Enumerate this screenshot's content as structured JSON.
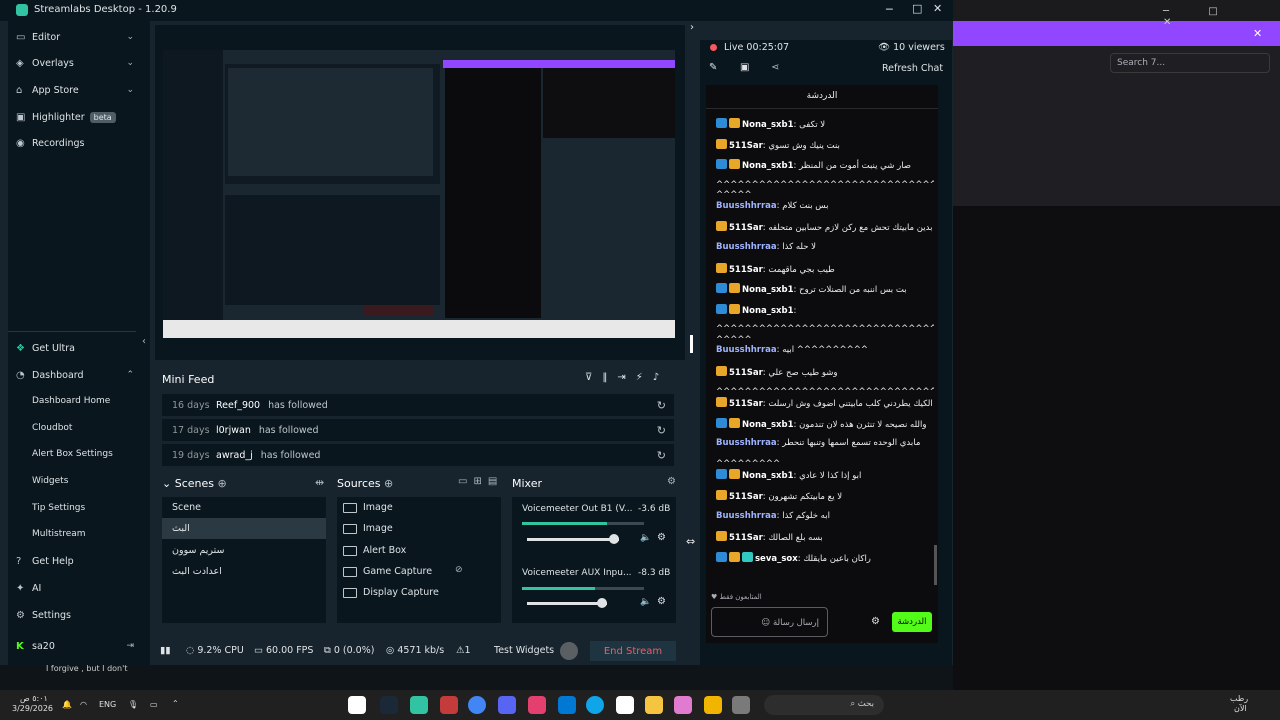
{
  "window": {
    "title": "Streamlabs Desktop - 1.20.9"
  },
  "sidebar": {
    "items": [
      {
        "label": "Editor"
      },
      {
        "label": "Overlays"
      },
      {
        "label": "App Store"
      },
      {
        "label": "Highlighter",
        "badge": "beta"
      },
      {
        "label": "Recordings"
      }
    ],
    "get_ultra": "Get Ultra",
    "dashboard": "Dashboard",
    "dashboard_items": [
      "Dashboard Home",
      "Cloudbot",
      "Alert Box Settings",
      "Widgets",
      "Tip Settings",
      "Multistream"
    ],
    "get_help": "Get Help",
    "ai": "AI",
    "settings": "Settings",
    "user": "sa20"
  },
  "mini_feed": {
    "title": "Mini Feed",
    "rows": [
      {
        "days": "16 days",
        "name": "Reef_900",
        "action": "has followed"
      },
      {
        "days": "17 days",
        "name": "l0rjwan",
        "action": "has followed"
      },
      {
        "days": "19 days",
        "name": "awrad_j",
        "action": "has followed"
      }
    ]
  },
  "scenes": {
    "title": "Scenes",
    "items": [
      "Scene",
      "البث",
      "ستريم سوون",
      "اعدادت البث"
    ]
  },
  "sources": {
    "title": "Sources",
    "items": [
      "Image",
      "Image",
      "Alert Box",
      "Game Capture",
      "Display Capture"
    ]
  },
  "mixer": {
    "title": "Mixer",
    "channels": [
      {
        "name": "Voicemeeter Out B1 (V...",
        "db": "-3.6 dB",
        "level": 0.7
      },
      {
        "name": "Voicemeeter AUX Inpu...",
        "db": "-8.3 dB",
        "level": 0.6
      }
    ]
  },
  "status": {
    "cpu": "9.2% CPU",
    "fps": "60.00 FPS",
    "dropped": "0 (0.0%)",
    "bitrate": "4571 kb/s",
    "alert_count": "1",
    "test_widgets": "Test Widgets",
    "end_stream": "End Stream"
  },
  "stream": {
    "live": "Live 00:25:07",
    "viewers": "10 viewers",
    "refresh_chat": "Refresh Chat"
  },
  "chat": {
    "header": "الدردشة",
    "input_placeholder": "إرسال رسالة",
    "send": "الدردشة",
    "followers_note": "المتابعون فقط",
    "messages": [
      {
        "user": "Nona_sxb1",
        "text": ": لا تكفى",
        "badges": [
          "blue",
          "gold"
        ],
        "color": "#ffffff"
      },
      {
        "user": "511Sar",
        "text": ": بنت ينيك وش تسوي",
        "badges": [
          "gold"
        ],
        "color": "#ffffff"
      },
      {
        "user": "Nona_sxb1",
        "text": ": صار شي ينبت أموت من المنظر",
        "badges": [
          "blue",
          "gold"
        ],
        "color": "#ffffff"
      },
      {
        "user": "",
        "text": "^^^^^^^^^^^^^^^^^^^^^^^^^^^^^^^^^^^^^^^^^^^^^^^^^^^^^^^^^^",
        "badges": [],
        "color": "#ffffff"
      },
      {
        "user": "",
        "text": "^^^^^",
        "badges": [],
        "color": "#ffffff"
      },
      {
        "user": "Buusshhrraa",
        "text": ": بس بنت كلام",
        "badges": [],
        "color": "#9fb4ff"
      },
      {
        "user": "511Sar",
        "text": ": بدين مابيتك تحش مع ركن لازم حسابين متحلفه",
        "badges": [
          "gold"
        ],
        "color": "#ffffff"
      },
      {
        "user": "Buusshhrraa",
        "text": ": لا حله كذا",
        "badges": [],
        "color": "#9fb4ff"
      },
      {
        "user": "511Sar",
        "text": ": طيب بجي ماقهمت",
        "badges": [
          "gold"
        ],
        "color": "#ffffff"
      },
      {
        "user": "Nona_sxb1",
        "text": ": بت بس اننبه من الصنلات تروح",
        "badges": [
          "blue",
          "gold"
        ],
        "color": "#ffffff"
      },
      {
        "user": "Nona_sxb1",
        "text": ":",
        "badges": [
          "blue",
          "gold"
        ],
        "color": "#ffffff"
      },
      {
        "user": "",
        "text": "^^^^^^^^^^^^^^^^^^^^^^^^^^^^^^^^^^^^^^^^^^^^^^^^^^^^^^^^^^",
        "badges": [],
        "color": "#ffffff"
      },
      {
        "user": "",
        "text": "^^^^^",
        "badges": [],
        "color": "#ffffff"
      },
      {
        "user": "Buusshhrraa",
        "text": ": ابيه ^^^^^^^^^^",
        "badges": [],
        "color": "#9fb4ff"
      },
      {
        "user": "511Sar",
        "text": ": وشو طيب صح علي",
        "badges": [
          "gold"
        ],
        "color": "#ffffff"
      },
      {
        "user": "",
        "text": "^^^^^^^^^^^^^^^^^^^^^^^^^^^^^^^^^^^^^^^^^^^^^^^^^",
        "badges": [],
        "color": "#ffffff"
      },
      {
        "user": "511Sar",
        "text": ": الكيك يطردني كلب مابيتني اضوف وش ارسلت",
        "badges": [
          "gold"
        ],
        "color": "#ffffff"
      },
      {
        "user": "Nona_sxb1",
        "text": ": والله نصيحه لا تنثرن هذه لان تندمون",
        "badges": [
          "blue",
          "gold"
        ],
        "color": "#ffffff"
      },
      {
        "user": "Buusshhrraa",
        "text": ": مابدي الوحده تسمع اسمها وتنبها تنحطر",
        "badges": [],
        "color": "#9fb4ff"
      },
      {
        "user": "",
        "text": "^^^^^^^^^",
        "badges": [],
        "color": "#ffffff"
      },
      {
        "user": "Nona_sxb1",
        "text": ": ابو إذا كذا لا عادي",
        "badges": [
          "blue",
          "gold"
        ],
        "color": "#ffffff"
      },
      {
        "user": "511Sar",
        "text": ": لا يع مابيتكم تشهرون",
        "badges": [
          "gold"
        ],
        "color": "#ffffff"
      },
      {
        "user": "Buusshhrraa",
        "text": ": ابه خلوكم كذا",
        "badges": [],
        "color": "#9fb4ff"
      },
      {
        "user": "511Sar",
        "text": ": بسه بلع الصالك",
        "badges": [
          "gold"
        ],
        "color": "#ffffff"
      },
      {
        "user": "seva_sox",
        "text": ": راكان باعين مايقلك",
        "badges": [
          "blue",
          "gold",
          "teal"
        ],
        "color": "#ffffff"
      }
    ]
  },
  "background_app": {
    "search_placeholder": "Search 7..."
  },
  "taskbar": {
    "time": "٥:٠١ ص",
    "date": "3/29/2026",
    "lang": "ENG",
    "notification": "I forgive , but I don't",
    "search_placeholder": "بحث",
    "weather": "رطب",
    "weather2": "الآن"
  }
}
